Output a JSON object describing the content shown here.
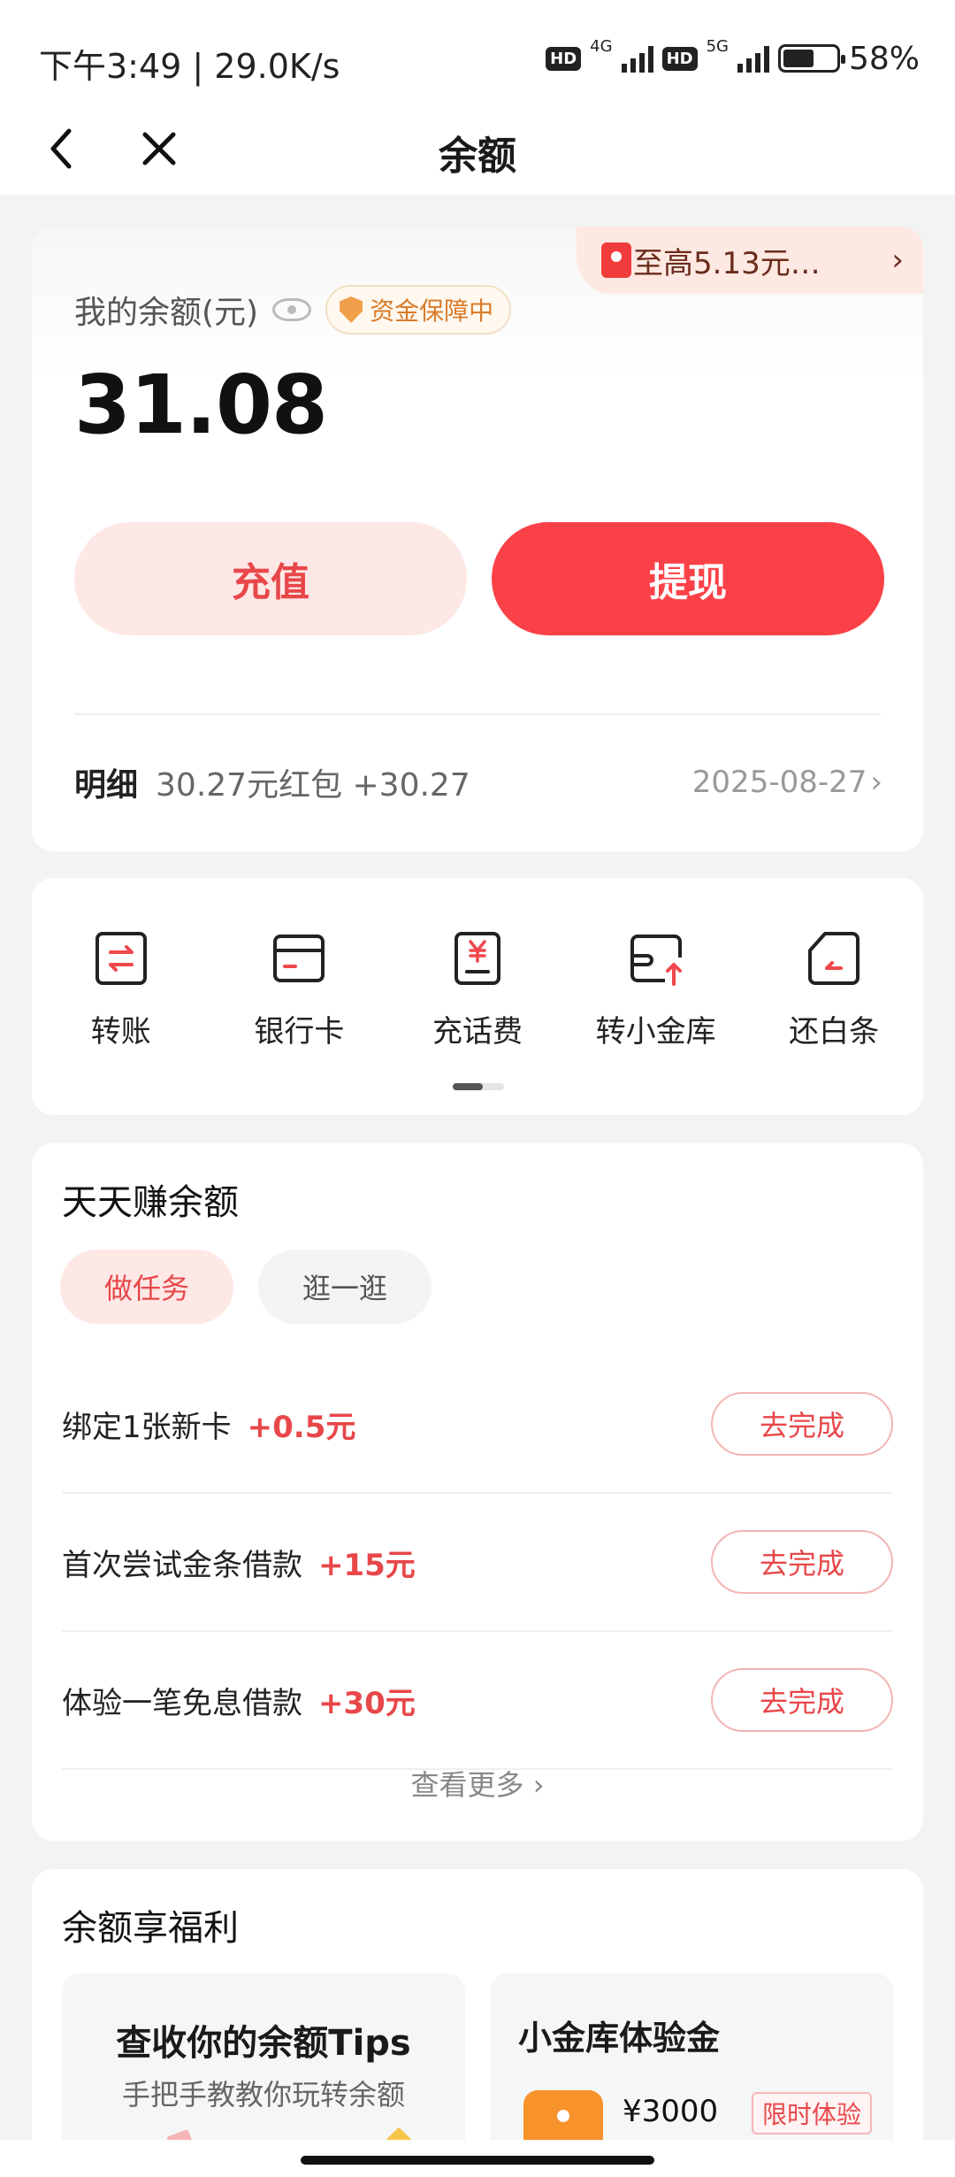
{
  "status_bar": {
    "time": "下午3:49 | 29.0K/s",
    "hd1": "HD",
    "net1": "4G",
    "hd2": "HD",
    "net2": "5G",
    "battery_percent": "58%",
    "battery_level": 0.58
  },
  "nav": {
    "title": "余额",
    "back_icon": "chevron-left-icon",
    "close_icon": "close-icon"
  },
  "balance": {
    "promo_text": "至高5.13元…",
    "label": "我的余额(元)",
    "safety_badge": "资金保障中",
    "amount": "31.08",
    "recharge_label": "充值",
    "withdraw_label": "提现",
    "detail_label": "明细",
    "detail_text": "30.27元红包 +30.27",
    "detail_date": "2025-08-27"
  },
  "shortcuts": [
    {
      "label": "转账",
      "icon": "transfer-icon"
    },
    {
      "label": "银行卡",
      "icon": "bank-card-icon"
    },
    {
      "label": "充话费",
      "icon": "phone-bill-icon"
    },
    {
      "label": "转小金库",
      "icon": "vault-transfer-icon"
    },
    {
      "label": "还白条",
      "icon": "repay-icon"
    }
  ],
  "tasks": {
    "title": "天天赚余额",
    "tabs": [
      "做任务",
      "逛一逛"
    ],
    "items": [
      {
        "name": "绑定1张新卡",
        "reward": "+0.5元",
        "action": "去完成"
      },
      {
        "name": "首次尝试金条借款",
        "reward": "+15元",
        "action": "去完成"
      },
      {
        "name": "体验一笔免息借款",
        "reward": "+30元",
        "action": "去完成"
      }
    ],
    "see_more": "查看更多"
  },
  "benefits": {
    "title": "余额享福利",
    "left_title": "查收你的余额Tips",
    "left_sub": "手把手教教你玩转余额",
    "right_title": "小金库体验金",
    "right_amount": "¥3000",
    "right_tag": "限时体验"
  },
  "colors": {
    "accent": "#fb4148",
    "accent_light": "#fde8e6",
    "background": "#f3f3f5"
  }
}
